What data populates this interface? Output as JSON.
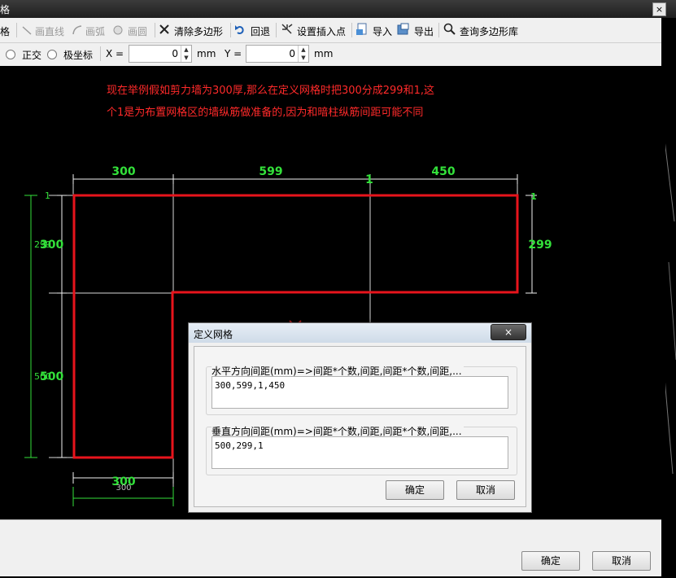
{
  "window": {
    "title_fragment": "格",
    "close_label": "×"
  },
  "toolbar": {
    "items": [
      {
        "label": "格"
      },
      {
        "label": "画直线",
        "enabled": false
      },
      {
        "label": "画弧",
        "enabled": false
      },
      {
        "label": "画圆",
        "enabled": false
      },
      {
        "label": "清除多边形",
        "enabled": true
      },
      {
        "label": "回退",
        "enabled": true
      },
      {
        "label": "设置插入点",
        "enabled": true
      },
      {
        "label": "导入",
        "enabled": true
      },
      {
        "label": "导出",
        "enabled": true
      },
      {
        "label": "查询多边形库",
        "enabled": true
      }
    ]
  },
  "options": {
    "ortho_label": "正交",
    "polar_label": "极坐标",
    "x_label": "X =",
    "x_value": "0",
    "x_unit": "mm",
    "y_label": "Y =",
    "y_value": "0",
    "y_unit": "mm"
  },
  "canvas": {
    "note_line1": "现在举例假如剪力墙为300厚,那么在定义网格时把300分成299和1,这",
    "note_line2": "个1是为布置网格区的墙纵筋做准备的,因为和暗柱纵筋间距可能不同",
    "dims_top": [
      "300",
      "599",
      "1",
      "450"
    ],
    "dim_right": "299",
    "dim_right_small": "1",
    "dims_left": [
      "1",
      "299",
      "300",
      "500",
      "500"
    ],
    "dim_bottom": "300",
    "dim_bottom_ghost": "300",
    "colors": {
      "outline": "#e8141c",
      "dimension": "#33e13a",
      "grid": "#d8d8d8"
    }
  },
  "dialog": {
    "title": "定义网格",
    "close_label": "×",
    "horizontal_label": "水平方向间距(mm)=>间距*个数,间距,间距*个数,间距,...",
    "horizontal_value": "300,599,1,450",
    "vertical_label": "垂直方向间距(mm)=>间距*个数,间距,间距*个数,间距,...",
    "vertical_value": "500,299,1",
    "ok_label": "确定",
    "cancel_label": "取消"
  },
  "footer": {
    "ok_label": "确定",
    "cancel_label": "取消"
  }
}
